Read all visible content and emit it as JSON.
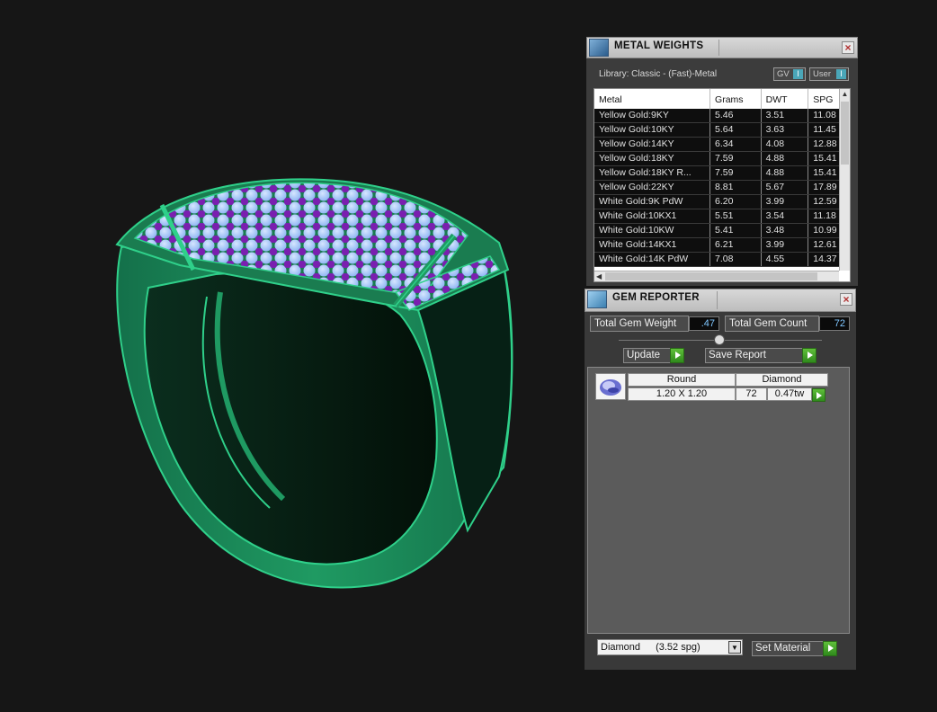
{
  "metal_weights": {
    "title": "METAL WEIGHTS",
    "library": "Library: Classic - (Fast)-Metal",
    "toggle_gv": "GV",
    "toggle_user": "User",
    "columns": [
      "Metal",
      "Grams",
      "DWT",
      "SPG"
    ],
    "rows": [
      [
        "Yellow Gold:9KY",
        "5.46",
        "3.51",
        "11.08"
      ],
      [
        "Yellow Gold:10KY",
        "5.64",
        "3.63",
        "11.45"
      ],
      [
        "Yellow Gold:14KY",
        "6.34",
        "4.08",
        "12.88"
      ],
      [
        "Yellow Gold:18KY",
        "7.59",
        "4.88",
        "15.41"
      ],
      [
        "Yellow Gold:18KY R...",
        "7.59",
        "4.88",
        "15.41"
      ],
      [
        "Yellow Gold:22KY",
        "8.81",
        "5.67",
        "17.89"
      ],
      [
        "White Gold:9K PdW",
        "6.20",
        "3.99",
        "12.59"
      ],
      [
        "White Gold:10KX1",
        "5.51",
        "3.54",
        "11.18"
      ],
      [
        "White Gold:10KW",
        "5.41",
        "3.48",
        "10.99"
      ],
      [
        "White Gold:14KX1",
        "6.21",
        "3.99",
        "12.61"
      ],
      [
        "White Gold:14K PdW",
        "7.08",
        "4.55",
        "14.37"
      ]
    ]
  },
  "gem_reporter": {
    "title": "GEM REPORTER",
    "total_gem_weight_label": "Total Gem Weight",
    "total_gem_weight": ".47",
    "total_gem_count_label": "Total Gem Count",
    "total_gem_count": "72",
    "update_label": "Update",
    "save_report_label": "Save Report",
    "gem": {
      "shape": "Round",
      "material": "Diamond",
      "size": "1.20 X 1.20",
      "count": "72",
      "weight": "0.47tw"
    },
    "material_select": {
      "name": "Diamond",
      "spg": "(3.52 spg)"
    },
    "set_material_label": "Set Material"
  },
  "colors": {
    "ring_green": "#1f8a57",
    "gem_blue": "#9ec3ff",
    "prong_purple": "#7a1fb0",
    "go_green": "#3fa52a"
  }
}
